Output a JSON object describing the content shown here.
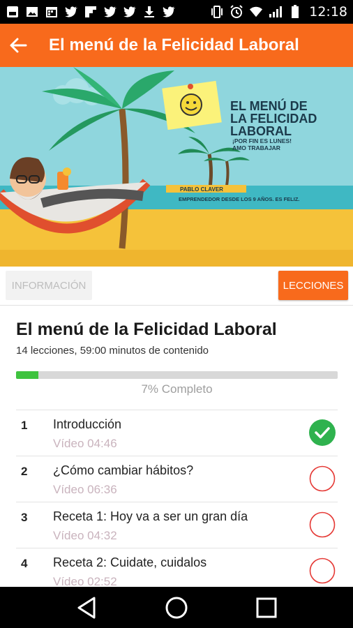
{
  "status_bar": {
    "time": "12:18",
    "left_icons": [
      "notification-square-icon",
      "image-icon",
      "calendar-icon",
      "twitter-icon",
      "flipboard-icon",
      "twitter-icon",
      "twitter-icon",
      "download-icon",
      "twitter-icon"
    ],
    "right_icons": [
      "vibrate-icon",
      "alarm-icon",
      "wifi-icon",
      "signal-icon",
      "battery-icon"
    ]
  },
  "app_bar": {
    "title": "El menú de la Felicidad Laboral",
    "back_icon": "arrow-back-icon",
    "color": "#f86a1c"
  },
  "banner": {
    "headline_lines": [
      "EL MENÚ DE",
      "LA FELICIDAD",
      "LABORAL"
    ],
    "tagline_lines": [
      "¡POR FIN ES LUNES!",
      "AMO TRABAJAR"
    ],
    "author": "PABLO CLAVER",
    "author_caption": "EMPRENDEDOR DESDE LOS 9 AÑOS. ES FELIZ."
  },
  "tabs": {
    "info_label": "INFORMACIÓN",
    "lessons_label": "LECCIONES",
    "active": "LECCIONES",
    "accent": "#f86a1c"
  },
  "course": {
    "title": "El menú de la Felicidad Laboral",
    "subtitle": "14 lecciones, 59:00 minutos de contenido",
    "progress_percent": 7,
    "progress_label": "7% Completo",
    "progress_color": "#3fc33f"
  },
  "lessons": [
    {
      "number": "1",
      "title": "Introducción",
      "meta": "Vídeo 04:46",
      "status": "completed"
    },
    {
      "number": "2",
      "title": "¿Cómo cambiar hábitos?",
      "meta": "Vídeo 06:36",
      "status": "pending"
    },
    {
      "number": "3",
      "title": "Receta 1: Hoy va a ser un gran día",
      "meta": "Vídeo 04:32",
      "status": "pending"
    },
    {
      "number": "4",
      "title": "Receta 2: Cuidate, cuidalos",
      "meta": "Vídeo 02:52",
      "status": "pending"
    }
  ],
  "nav_bar": {
    "icons": [
      "back-triangle-icon",
      "home-circle-icon",
      "recents-square-icon"
    ]
  }
}
